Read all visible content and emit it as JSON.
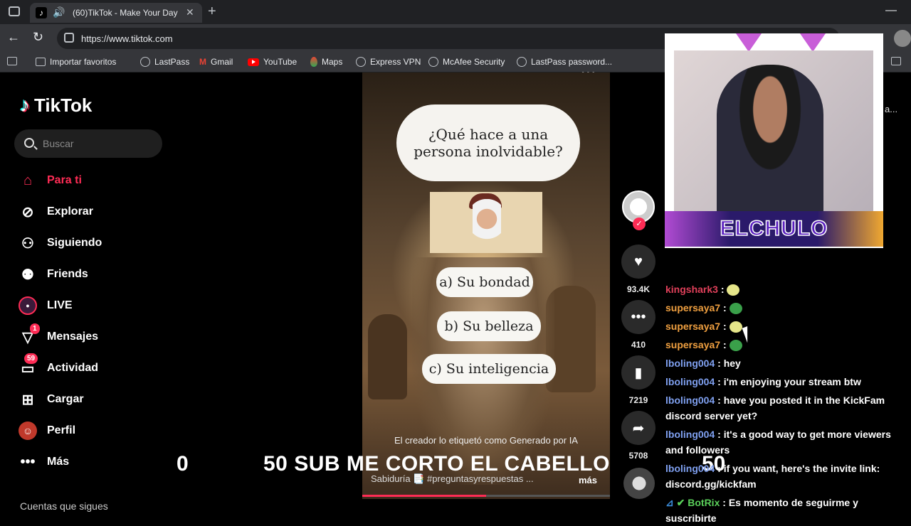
{
  "browser": {
    "tab_title": "(60)TikTok - Make Your Day",
    "tab_close": "✕",
    "new_tab": "+",
    "url": "https://www.tiktok.com",
    "minimize": "—"
  },
  "bookmarks": [
    {
      "label": "Importar favoritos",
      "icon": "folder-icon"
    },
    {
      "label": "LastPass",
      "icon": "globe-icon"
    },
    {
      "label": "Gmail",
      "icon": "gmail-icon"
    },
    {
      "label": "YouTube",
      "icon": "youtube-icon"
    },
    {
      "label": "Maps",
      "icon": "maps-icon"
    },
    {
      "label": "Express VPN",
      "icon": "globe-icon"
    },
    {
      "label": "McAfee Security",
      "icon": "globe-icon"
    },
    {
      "label": "LastPass password...",
      "icon": "globe-icon"
    }
  ],
  "tiktok": {
    "logo": "TikTok",
    "search_placeholder": "Buscar",
    "nav": [
      {
        "label": "Para ti",
        "icon": "home-icon",
        "active": true
      },
      {
        "label": "Explorar",
        "icon": "compass-icon"
      },
      {
        "label": "Siguiendo",
        "icon": "following-icon"
      },
      {
        "label": "Friends",
        "icon": "friends-icon"
      },
      {
        "label": "LIVE",
        "icon": "live-icon"
      },
      {
        "label": "Mensajes",
        "icon": "messages-icon",
        "badge": "1"
      },
      {
        "label": "Actividad",
        "icon": "activity-icon",
        "badge": "59"
      },
      {
        "label": "Cargar",
        "icon": "upload-icon"
      },
      {
        "label": "Perfil",
        "icon": "profile-icon"
      },
      {
        "label": "Más",
        "icon": "more-icon"
      }
    ],
    "following_title": "Cuentas que sigues"
  },
  "video": {
    "question": "¿Qué hace a una persona inolvidable?",
    "options": [
      "a) Su bondad",
      "b) Su belleza",
      "c) Su inteligencia"
    ],
    "ai_label": "El creador lo etiquetó como Generado por IA",
    "caption": "Sabiduría 📑 #preguntasyrespuestas ...",
    "more": "más",
    "dots": "•••",
    "progress": 0.5
  },
  "actions": {
    "likes": "93.4K",
    "comments": "410",
    "saves": "7219",
    "shares": "5708"
  },
  "overlay": {
    "left_count": "0",
    "goal_text": "50 SUB ME CORTO EL CABELLO",
    "right_count": "50"
  },
  "stream": {
    "streamer_name": "ELCHULO",
    "side_fragment": "a..."
  },
  "chat": [
    {
      "user": "kingshark3",
      "color": "#e0405a",
      "text": "",
      "emote": "emote-icon"
    },
    {
      "user": "supersaya7",
      "color": "#f0a040",
      "text": "",
      "emote": "emote-icon"
    },
    {
      "user": "supersaya7",
      "color": "#f0a040",
      "text": "",
      "emote": "emote-icon"
    },
    {
      "user": "supersaya7",
      "color": "#f0a040",
      "text": "",
      "emote": "emote-icon"
    },
    {
      "user": "lboling004",
      "color": "#7fa0f0",
      "text": "hey"
    },
    {
      "user": "lboling004",
      "color": "#7fa0f0",
      "text": "i'm enjoying your stream btw"
    },
    {
      "user": "lboling004",
      "color": "#7fa0f0",
      "text": "have you posted it in the KickFam discord server yet?"
    },
    {
      "user": "lboling004",
      "color": "#7fa0f0",
      "text": "it's a good way to get more viewers and followers"
    },
    {
      "user": "lboling004",
      "color": "#7fa0f0",
      "text": "if you want, here's the invite link: discord.gg/kickfam"
    },
    {
      "user": "BotRix",
      "color": "#5ad05a",
      "text": "Es momento de seguirme y suscribirte"
    }
  ]
}
